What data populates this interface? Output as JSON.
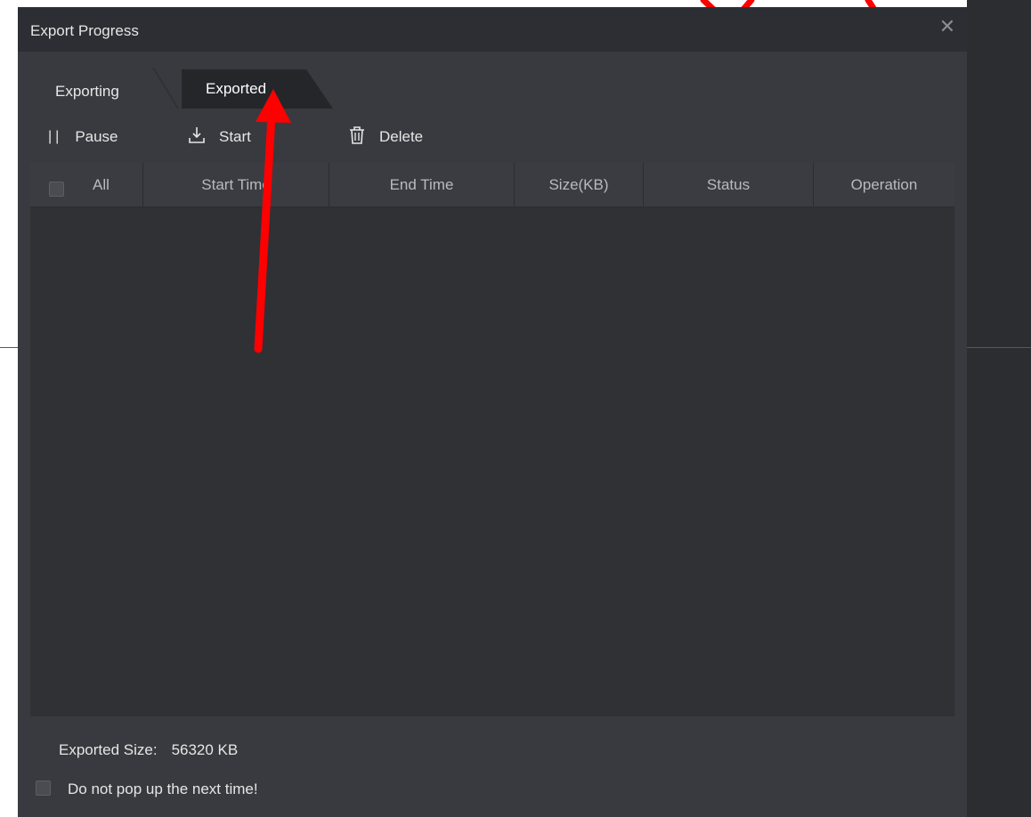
{
  "dialog": {
    "title": "Export Progress",
    "close_glyph": "✕"
  },
  "tabs": [
    {
      "label": "Exporting",
      "active": false
    },
    {
      "label": "Exported",
      "active": true
    }
  ],
  "toolbar": {
    "pause_label": "Pause",
    "start_label": "Start",
    "delete_label": "Delete"
  },
  "table": {
    "headers": {
      "all": "All",
      "start_time": "Start Time",
      "end_time": "End Time",
      "size": "Size(KB)",
      "status": "Status",
      "operation": "Operation"
    },
    "rows": []
  },
  "footer": {
    "exported_size_label": "Exported Size:",
    "exported_size_value": "56320 KB",
    "no_popup_label": "Do not pop up the next time!"
  },
  "colors": {
    "dialog_bg": "#383a3f",
    "titlebar_bg": "#2c2e33",
    "annotation_arrow": "#ff0000"
  }
}
